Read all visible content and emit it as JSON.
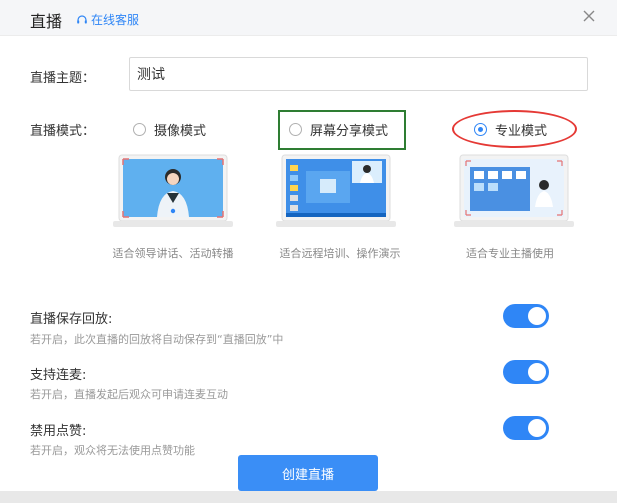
{
  "header": {
    "title": "直播",
    "service_label": "在线客服"
  },
  "form": {
    "topic_label": "直播主题：",
    "topic_value": "测试",
    "mode_label": "直播模式："
  },
  "modes": [
    {
      "label": "摄像模式",
      "caption": "适合领导讲话、活动转播",
      "selected": false
    },
    {
      "label": "屏幕分享模式",
      "caption": "适合远程培训、操作演示",
      "selected": false
    },
    {
      "label": "专业模式",
      "caption": "适合专业主播使用",
      "selected": true
    }
  ],
  "options": [
    {
      "title": "直播保存回放:",
      "desc": "若开启，此次直播的回放将自动保存到“直播回放”中",
      "enabled": true
    },
    {
      "title": "支持连麦:",
      "desc": "若开启，直播发起后观众可申请连麦互动",
      "enabled": true
    },
    {
      "title": "禁用点赞:",
      "desc": "若开启，观众将无法使用点赞功能",
      "enabled": true
    }
  ],
  "actions": {
    "create_label": "创建直播"
  },
  "colors": {
    "accent": "#2f86f6",
    "highlight_green": "#2e7d32",
    "highlight_red": "#e53935"
  }
}
